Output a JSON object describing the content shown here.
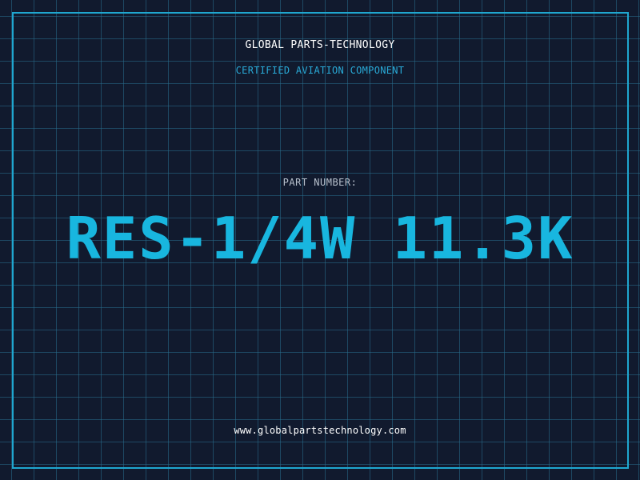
{
  "header": {
    "company": "GLOBAL PARTS-TECHNOLOGY",
    "subtitle": "CERTIFIED AVIATION COMPONENT"
  },
  "main": {
    "label": "PART NUMBER:",
    "part_number": "RES-1/4W 11.3K"
  },
  "footer": {
    "url": "www.globalpartstechnology.com"
  },
  "colors": {
    "background": "#111a2e",
    "grid": "#286e8c",
    "accent": "#18b6df",
    "text_primary": "#ffffff",
    "text_muted": "#b7c0cc"
  }
}
